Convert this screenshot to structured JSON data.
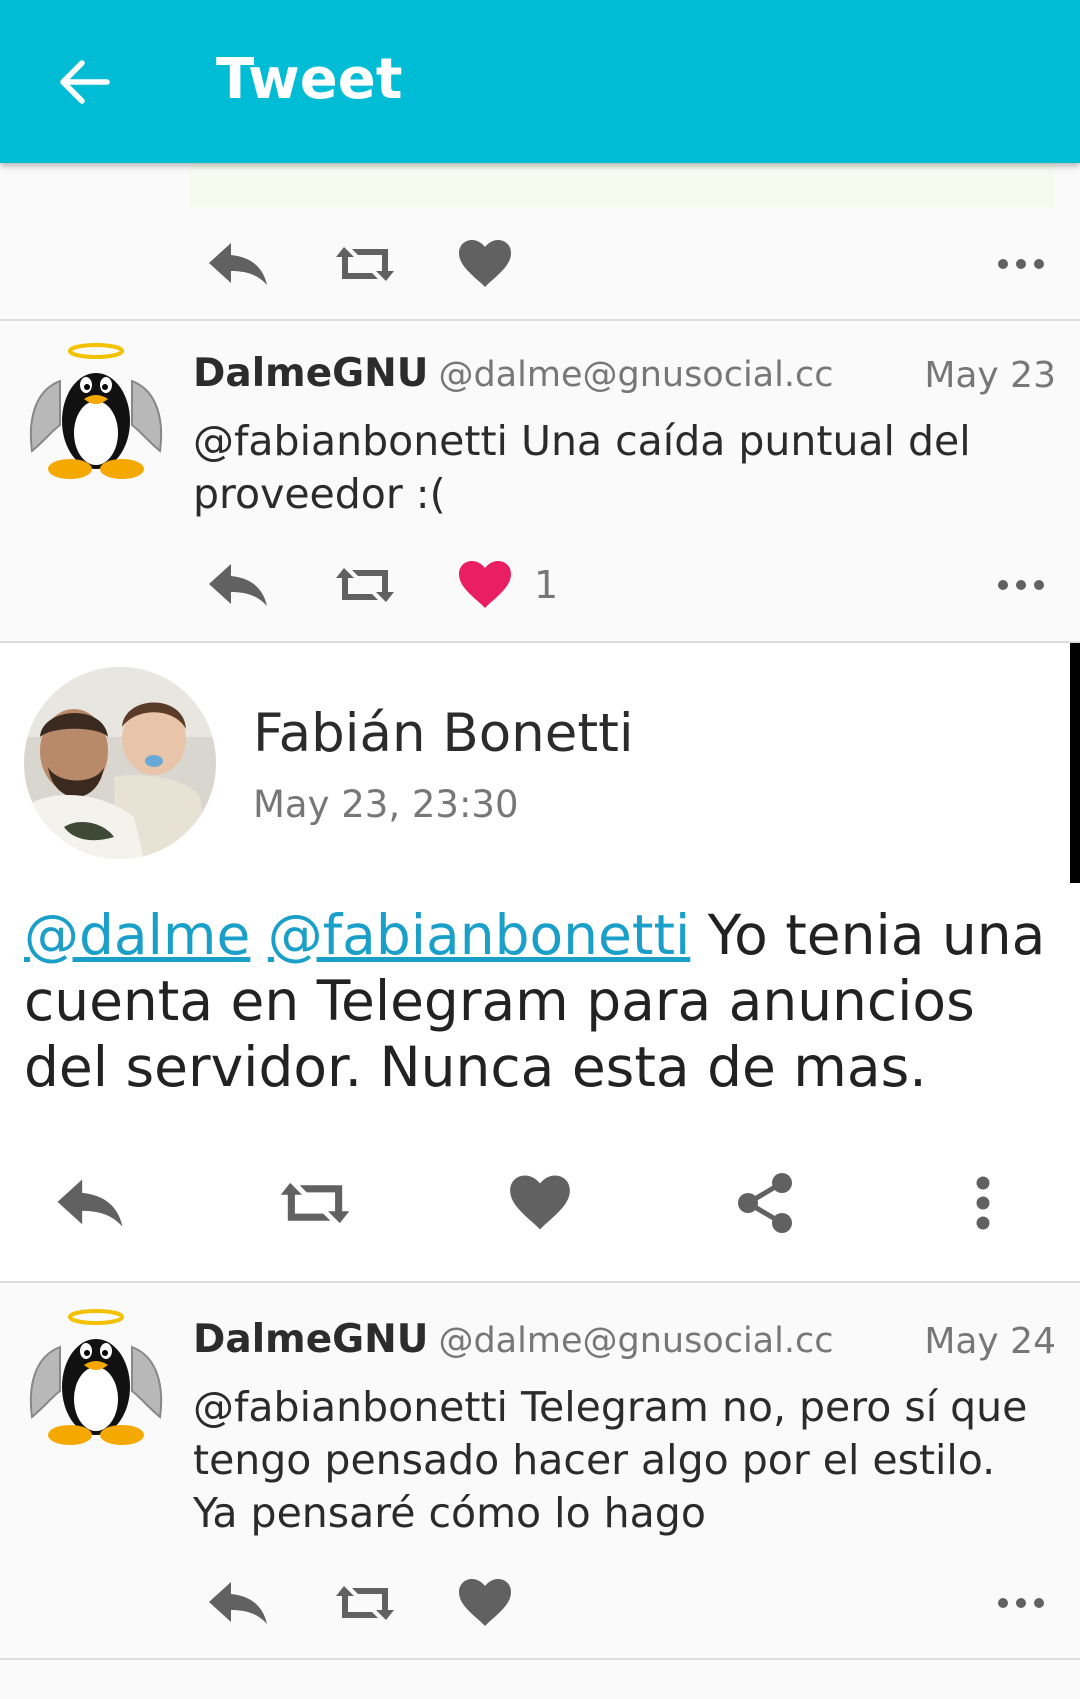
{
  "appbar": {
    "title": "Tweet"
  },
  "tweets": [
    {
      "name": "DalmeGNU",
      "handle": "@dalme@gnusocial.cc",
      "date": "May 23",
      "text": "@fabianbonetti Una caída puntual del proveedor :(",
      "like_count": "1",
      "liked": true
    },
    {
      "name": "DalmeGNU",
      "handle": "@dalme@gnusocial.cc",
      "date": "May 24",
      "text": "@fabianbonetti Telegram no, pero sí que tengo pensado hacer algo por el estilo. Ya pensaré cómo lo hago"
    }
  ],
  "detail": {
    "name": "Fabián Bonetti",
    "date": "May 23, 23:30",
    "mention1": "@dalme",
    "mention2": "@fabianbonetti",
    "text": "Yo tenia una cuenta en Telegram para anuncios del servidor. Nunca esta de mas."
  },
  "colors": {
    "appbar": "#00bcd4",
    "like_active": "#e91e63",
    "icon": "#616161",
    "mention": "#1a9fc9"
  }
}
